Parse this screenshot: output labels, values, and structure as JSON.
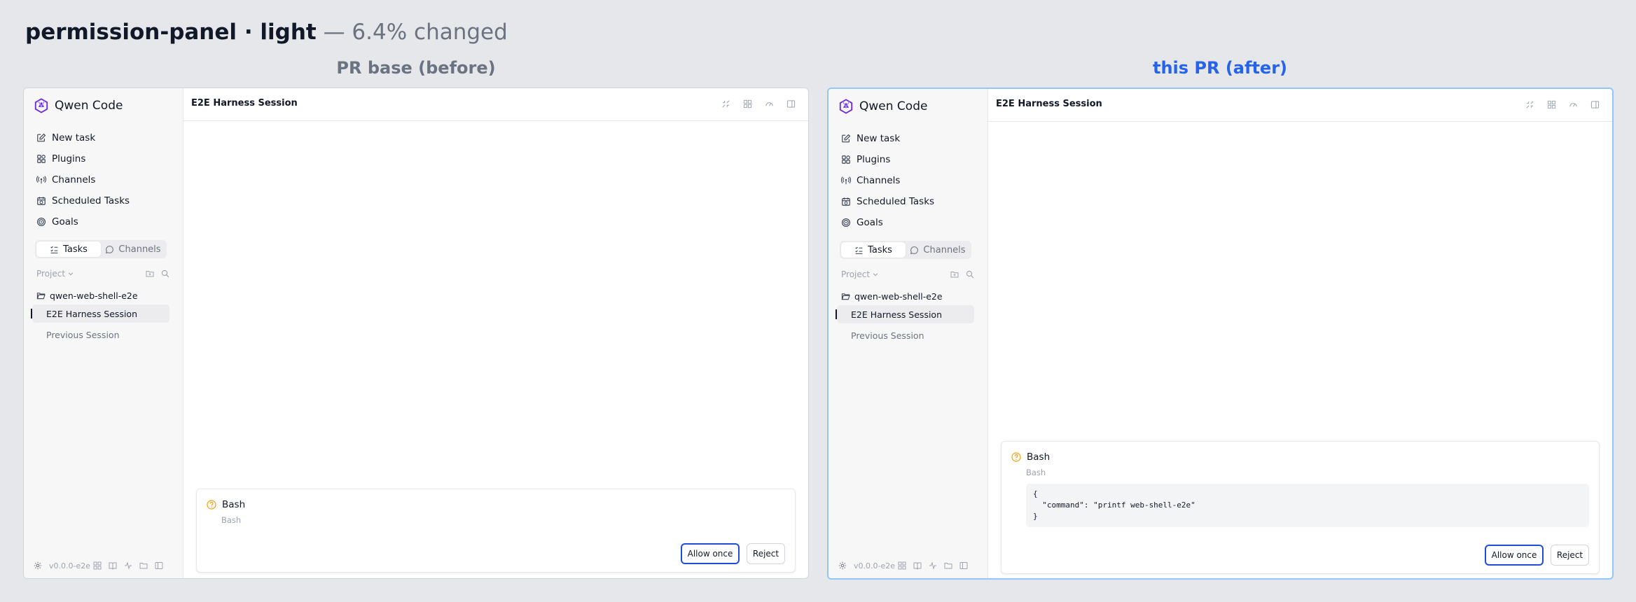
{
  "header": {
    "title_strong": "permission-panel · light",
    "title_suffix": " — 6.4% changed"
  },
  "captions": {
    "before": "PR base (before)",
    "after": "this PR (after)"
  },
  "colors": {
    "page_background": "#e5e7eb",
    "after_caption": "#2563eb",
    "allow_button_border": "#1d4ed8",
    "warning_icon": "#f59e0b",
    "brand_logo": "#6d28d9"
  },
  "before": {
    "app_name": "Qwen Code",
    "nav": [
      {
        "label": "New task",
        "icon": "edit-icon"
      },
      {
        "label": "Plugins",
        "icon": "plugins-icon"
      },
      {
        "label": "Channels",
        "icon": "antenna-icon"
      },
      {
        "label": "Scheduled Tasks",
        "icon": "calendar-clock-icon"
      },
      {
        "label": "Goals",
        "icon": "target-icon"
      }
    ],
    "segment": {
      "tasks": "Tasks",
      "channels": "Channels"
    },
    "project_label": "Project",
    "folder_name": "qwen-web-shell-e2e",
    "sessions": {
      "active": "E2E Harness Session",
      "previous": "Previous Session"
    },
    "version": "v0.0.0-e2e",
    "session_title": "E2E Harness Session",
    "permission": {
      "tool": "Bash",
      "subtitle": "Bash",
      "allow_label": "Allow once",
      "reject_label": "Reject"
    }
  },
  "after": {
    "app_name": "Qwen Code",
    "nav": [
      {
        "label": "New task",
        "icon": "edit-icon"
      },
      {
        "label": "Plugins",
        "icon": "plugins-icon"
      },
      {
        "label": "Channels",
        "icon": "antenna-icon"
      },
      {
        "label": "Scheduled Tasks",
        "icon": "calendar-clock-icon"
      },
      {
        "label": "Goals",
        "icon": "target-icon"
      }
    ],
    "segment": {
      "tasks": "Tasks",
      "channels": "Channels"
    },
    "project_label": "Project",
    "folder_name": "qwen-web-shell-e2e",
    "sessions": {
      "active": "E2E Harness Session",
      "previous": "Previous Session"
    },
    "version": "v0.0.0-e2e",
    "session_title": "E2E Harness Session",
    "permission": {
      "tool": "Bash",
      "subtitle": "Bash",
      "code_lines": [
        "{",
        "  \"command\": \"printf web-shell-e2e\"",
        "}"
      ],
      "allow_label": "Allow once",
      "reject_label": "Reject"
    }
  }
}
